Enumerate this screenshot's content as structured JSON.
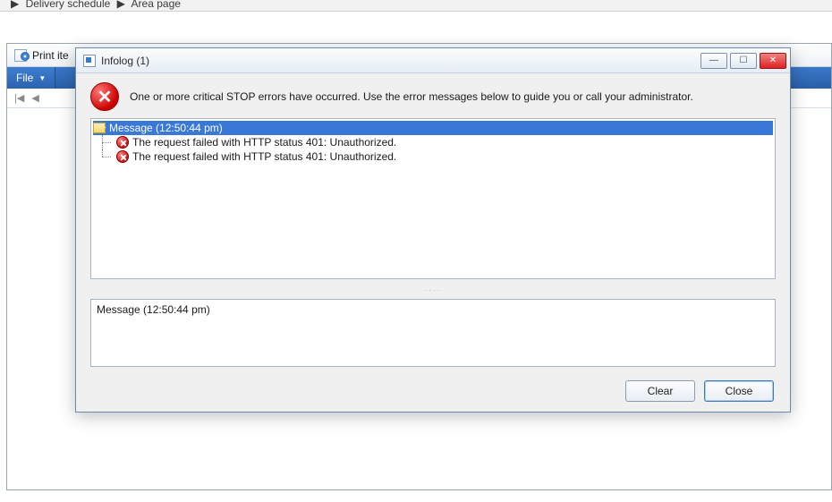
{
  "breadcrumbs": {
    "item1": "Delivery schedule",
    "item2": "Area page",
    "sep": "▶"
  },
  "background": {
    "tab_title": "Print ite",
    "file_menu": "File"
  },
  "dialog": {
    "title": "Infolog (1)",
    "summary": "One or more critical STOP errors have occurred. Use the error messages below to guide you or call your administrator.",
    "tree": {
      "root_label": "Message (12:50:44 pm)",
      "children": [
        "The request failed with HTTP status 401: Unauthorized.",
        "The request failed with HTTP status 401: Unauthorized."
      ]
    },
    "detail_text": "Message (12:50:44 pm)",
    "buttons": {
      "clear": "Clear",
      "close": "Close"
    }
  }
}
